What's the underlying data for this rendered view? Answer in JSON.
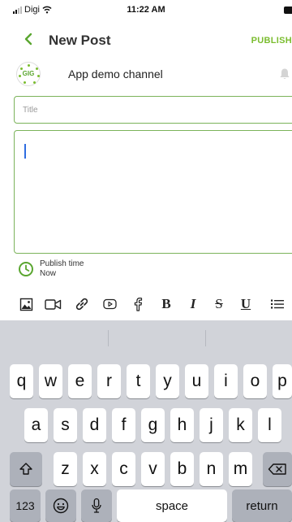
{
  "status_bar": {
    "carrier": "Digi",
    "time": "11:22 AM"
  },
  "nav": {
    "back_icon": "chevron-left-icon",
    "title": "New Post",
    "publish_label": "PUBLISH"
  },
  "channel": {
    "logo_text": "GIG",
    "name": "App demo channel",
    "notify_icon": "bell-icon"
  },
  "form": {
    "title_placeholder": "Title",
    "body_value": ""
  },
  "publish_time": {
    "label": "Publish time",
    "value": "Now"
  },
  "toolbar": {
    "tools": [
      {
        "name": "insert-image",
        "icon": "image-icon"
      },
      {
        "name": "insert-video",
        "icon": "video-icon"
      },
      {
        "name": "insert-link",
        "icon": "link-icon"
      },
      {
        "name": "insert-youtube",
        "icon": "youtube-icon"
      },
      {
        "name": "insert-facebook",
        "icon": "facebook-icon"
      },
      {
        "name": "bold",
        "label": "B"
      },
      {
        "name": "italic",
        "label": "I"
      },
      {
        "name": "strikethrough",
        "label": "S"
      },
      {
        "name": "underline",
        "label": "U"
      },
      {
        "name": "bulleted-list",
        "icon": "list-icon"
      }
    ]
  },
  "keyboard": {
    "row1": [
      "q",
      "w",
      "e",
      "r",
      "t",
      "y",
      "u",
      "i",
      "o",
      "p"
    ],
    "row2": [
      "a",
      "s",
      "d",
      "f",
      "g",
      "h",
      "j",
      "k",
      "l"
    ],
    "row3": [
      "z",
      "x",
      "c",
      "v",
      "b",
      "n",
      "m"
    ],
    "shift_icon": "shift-icon",
    "delete_icon": "delete-icon",
    "numbers_label": "123",
    "emoji_icon": "emoji-icon",
    "mic_icon": "microphone-icon",
    "space_label": "space",
    "return_label": "return"
  }
}
